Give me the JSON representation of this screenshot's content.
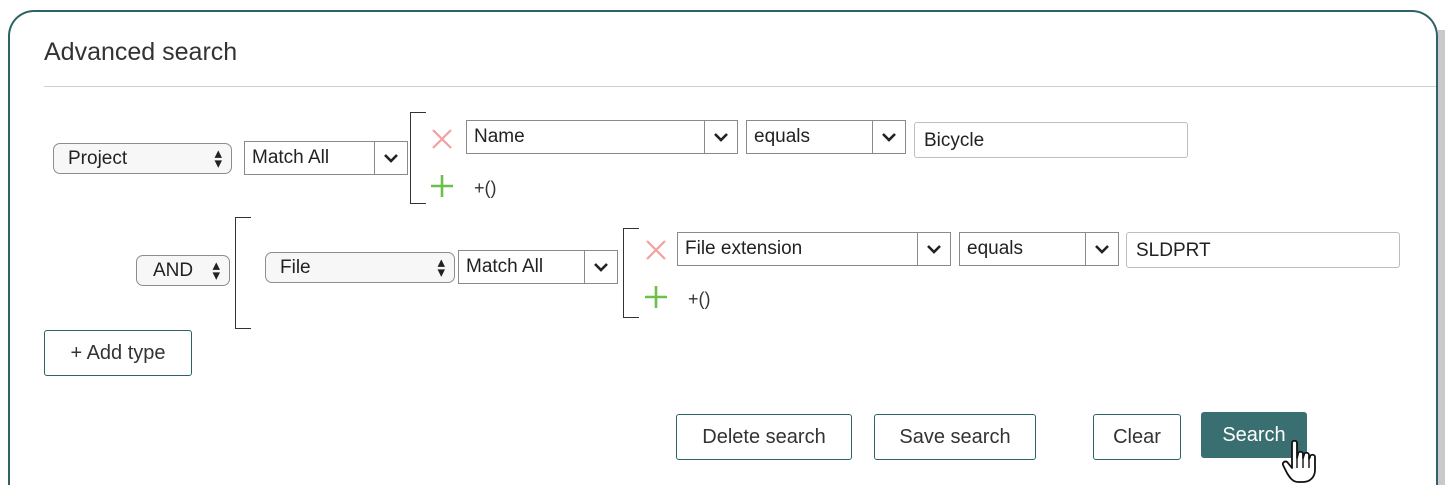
{
  "title": "Advanced search",
  "row1": {
    "type_select": "Project",
    "match_select": "Match All",
    "condition": {
      "field": "Name",
      "operator": "equals",
      "value": "Bicycle"
    },
    "add_group_label": "+()"
  },
  "row2": {
    "logic_select": "AND",
    "type_select": "File",
    "match_select": "Match All",
    "condition": {
      "field": "File extension",
      "operator": "equals",
      "value": "SLDPRT"
    },
    "add_group_label": "+()"
  },
  "add_type_label": "+ Add type",
  "footer": {
    "delete_label": "Delete search",
    "save_label": "Save search",
    "clear_label": "Clear",
    "search_label": "Search"
  },
  "colors": {
    "accent": "#3a6f72",
    "remove": "#f2a0a0",
    "add": "#6cbf4a"
  }
}
